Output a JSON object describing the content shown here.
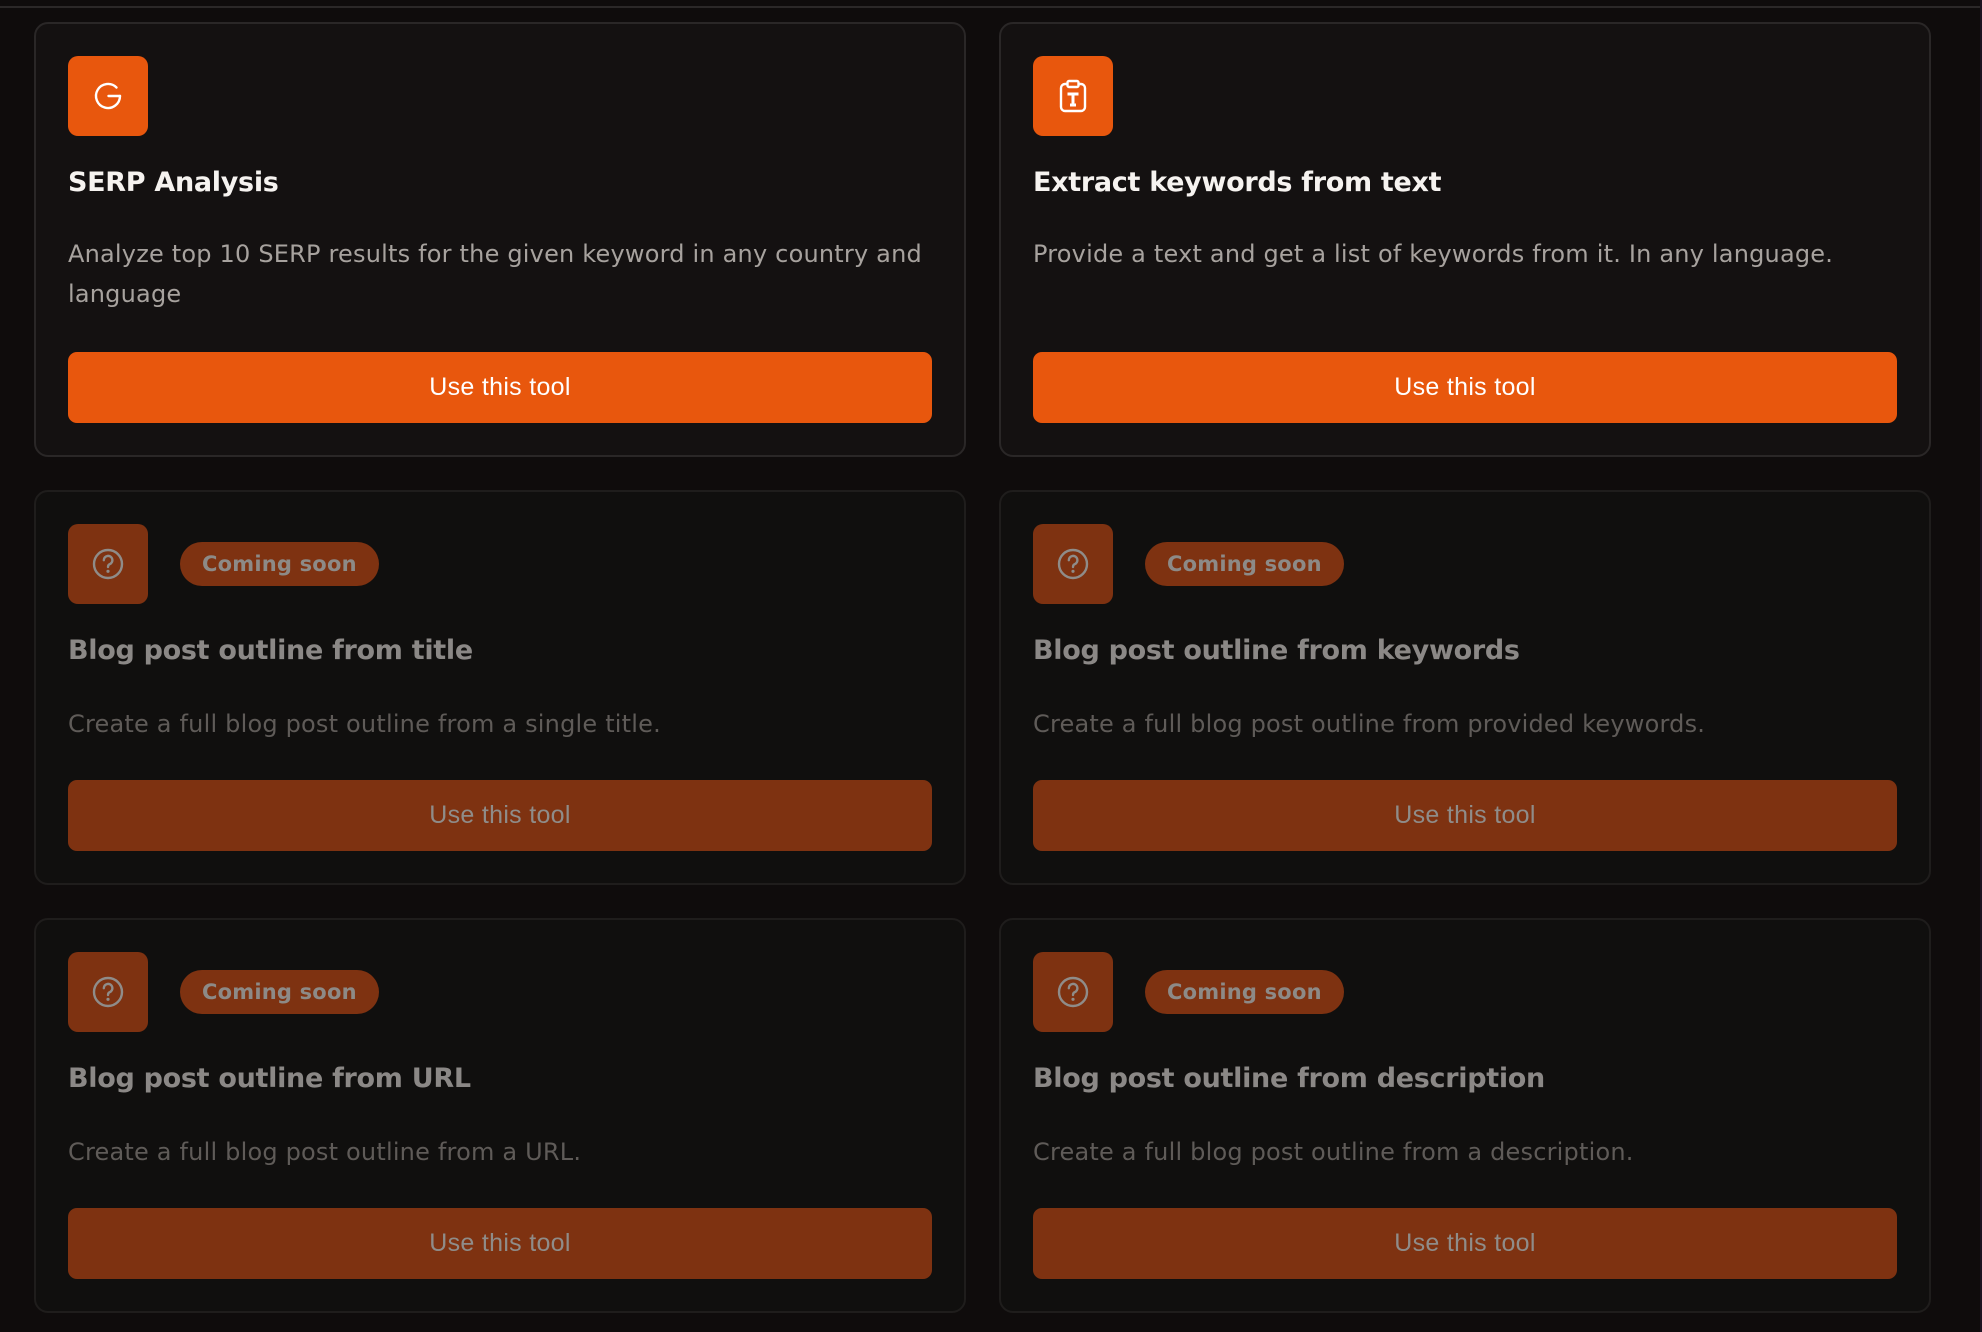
{
  "colors": {
    "accent": "#e8570d",
    "accent_disabled": "#7e3211",
    "background": "#0f0c0c",
    "card_background": "#141111"
  },
  "tools": [
    {
      "icon": "google-g-icon",
      "title": "SERP Analysis",
      "description": "Analyze top 10 SERP results for the given keyword in any country and language",
      "button_label": "Use this tool",
      "status": "available"
    },
    {
      "icon": "clipboard-text-icon",
      "title": "Extract keywords from text",
      "description": "Provide a text and get a list of keywords from it. In any language.",
      "button_label": "Use this tool",
      "status": "available"
    },
    {
      "icon": "question-circle-icon",
      "badge": "Coming soon",
      "title": "Blog post outline from title",
      "description": "Create a full blog post outline from a single title.",
      "button_label": "Use this tool",
      "status": "coming-soon"
    },
    {
      "icon": "question-circle-icon",
      "badge": "Coming soon",
      "title": "Blog post outline from keywords",
      "description": "Create a full blog post outline from provided keywords.",
      "button_label": "Use this tool",
      "status": "coming-soon"
    },
    {
      "icon": "question-circle-icon",
      "badge": "Coming soon",
      "title": "Blog post outline from URL",
      "description": "Create a full blog post outline from a URL.",
      "button_label": "Use this tool",
      "status": "coming-soon"
    },
    {
      "icon": "question-circle-icon",
      "badge": "Coming soon",
      "title": "Blog post outline from description",
      "description": "Create a full blog post outline from a description.",
      "button_label": "Use this tool",
      "status": "coming-soon"
    }
  ]
}
